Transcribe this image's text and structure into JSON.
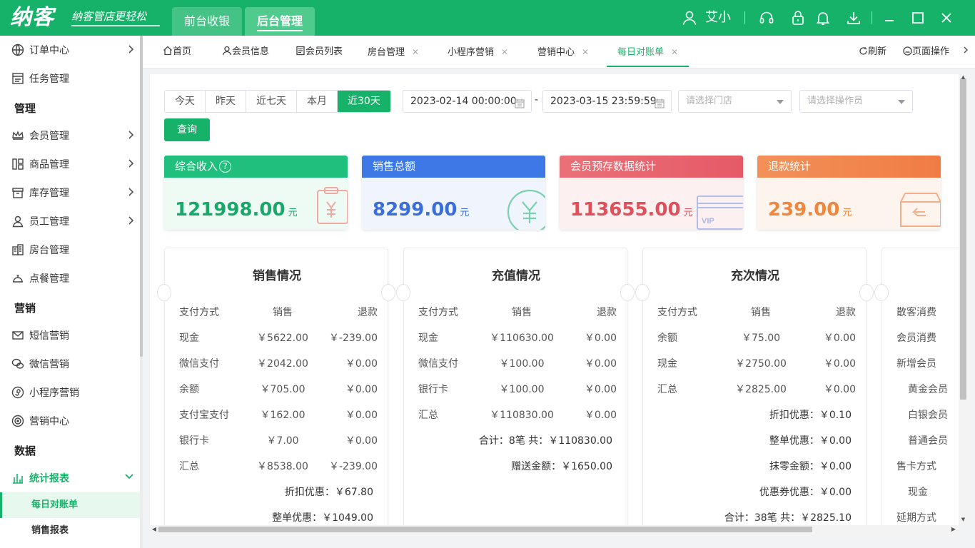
{
  "header": {
    "logo": "纳客",
    "slogan": "纳客管店更轻松",
    "nav": [
      "前台收银",
      "后台管理"
    ],
    "username": "艾小",
    "icons": [
      "user-icon",
      "headset-icon",
      "lock-icon",
      "bell-icon",
      "download-icon",
      "minimize-icon",
      "maximize-icon",
      "close-icon"
    ]
  },
  "sidebar": {
    "items": [
      {
        "label": "订单中心",
        "icon": "globe-icon"
      },
      {
        "label": "任务管理",
        "icon": "task-icon"
      },
      {
        "label": "会员管理",
        "icon": "crown-icon"
      },
      {
        "label": "商品管理",
        "icon": "goods-icon"
      },
      {
        "label": "库存管理",
        "icon": "inventory-icon"
      },
      {
        "label": "员工管理",
        "icon": "staff-icon"
      },
      {
        "label": "房台管理",
        "icon": "building-icon"
      },
      {
        "label": "点餐管理",
        "icon": "dining-bell-icon"
      },
      {
        "label": "短信营销",
        "icon": "mail-icon"
      },
      {
        "label": "微信营销",
        "icon": "wechat-icon"
      },
      {
        "label": "小程序营销",
        "icon": "miniapp-icon"
      },
      {
        "label": "营销中心",
        "icon": "target-icon"
      },
      {
        "label": "统计报表",
        "icon": "bar-chart-icon"
      }
    ],
    "headings": [
      "管理",
      "营销",
      "数据"
    ],
    "sub_items": [
      "每日对账单",
      "销售报表"
    ]
  },
  "tabs": {
    "items": [
      "首页",
      "会员信息",
      "会员列表",
      "房台管理",
      "小程序营销",
      "营销中心",
      "每日对账单"
    ],
    "refresh": "刷新",
    "page_ops": "页面操作"
  },
  "filter": {
    "quick": [
      "今天",
      "昨天",
      "近七天",
      "本月",
      "近30天"
    ],
    "active_quick": "近30天",
    "start": "2023-02-14 00:00:00",
    "dash": "-",
    "end": "2023-03-15 23:59:59",
    "store_placeholder": "请选择门店",
    "operator_placeholder": "请选择操作员",
    "query": "查询"
  },
  "cards": [
    {
      "title": "综合收入",
      "value": "121998.00",
      "unit": "元",
      "color": "#20bf7d",
      "valueColor": "#1aa86a",
      "bg": "#eefbf5"
    },
    {
      "title": "销售总额",
      "value": "8299.00",
      "unit": "元",
      "color": "#3e78e6",
      "valueColor": "#3a6fd8",
      "bg": "#f0f5fd"
    },
    {
      "title": "会员预存数据统计",
      "value": "113655.00",
      "unit": "元",
      "color": "#e8636c",
      "valueColor": "#e0505a",
      "bg": "#fdf0f1"
    },
    {
      "title": "退款统计",
      "value": "239.00",
      "unit": "元",
      "color": "#f2874f",
      "valueColor": "#f0873e",
      "bg": "#fdf4ee"
    }
  ],
  "sales": {
    "title": "销售情况",
    "headers": [
      "支付方式",
      "销售",
      "退款"
    ],
    "rows": [
      [
        "现金",
        "￥5622.00",
        "￥-239.00"
      ],
      [
        "微信支付",
        "￥2042.00",
        "￥0.00"
      ],
      [
        "余额",
        "￥705.00",
        "￥0.00"
      ],
      [
        "支付宝支付",
        "￥162.00",
        "￥0.00"
      ],
      [
        "银行卡",
        "￥7.00",
        "￥0.00"
      ],
      [
        "汇总",
        "￥8538.00",
        "￥-239.00"
      ]
    ],
    "extra": [
      {
        "label": "折扣优惠：",
        "value": "￥67.80"
      },
      {
        "label": "整单优惠：",
        "value": "￥1049.00"
      }
    ]
  },
  "recharge": {
    "title": "充值情况",
    "headers": [
      "支付方式",
      "销售",
      "退款"
    ],
    "rows": [
      [
        "现金",
        "￥110630.00",
        "￥0.00"
      ],
      [
        "微信支付",
        "￥100.00",
        "￥0.00"
      ],
      [
        "银行卡",
        "￥100.00",
        "￥0.00"
      ],
      [
        "汇总",
        "￥110830.00",
        "￥0.00"
      ]
    ],
    "extra": [
      {
        "label": "合计：8笔 共：",
        "value": "￥110830.00"
      },
      {
        "label": "赠送金额：",
        "value": "￥1650.00"
      }
    ]
  },
  "times": {
    "title": "充次情况",
    "headers": [
      "支付方式",
      "销售",
      "退款"
    ],
    "rows": [
      [
        "余额",
        "￥75.00",
        "￥0.00"
      ],
      [
        "现金",
        "￥2750.00",
        "￥0.00"
      ],
      [
        "汇总",
        "￥2825.00",
        "￥0.00"
      ]
    ],
    "extra": [
      {
        "label": "折扣优惠：",
        "value": "￥0.10"
      },
      {
        "label": "整单优惠：",
        "value": "￥0.00"
      },
      {
        "label": "抹零金额：",
        "value": "￥0.00"
      },
      {
        "label": "优惠券优惠：",
        "value": "￥0.00"
      },
      {
        "label": "合计：38笔 共：",
        "value": "￥2825.10"
      }
    ]
  },
  "members": {
    "rows": [
      {
        "label": "散客消费",
        "indent": false
      },
      {
        "label": "会员消费",
        "indent": false
      },
      {
        "label": "新增会员",
        "indent": false
      },
      {
        "label": "黄金会员",
        "indent": true
      },
      {
        "label": "白银会员",
        "indent": true
      },
      {
        "label": "普通会员",
        "indent": true
      },
      {
        "label": "售卡方式",
        "indent": false
      },
      {
        "label": "现金",
        "indent": true
      },
      {
        "label": "延期方式",
        "indent": false
      }
    ]
  }
}
